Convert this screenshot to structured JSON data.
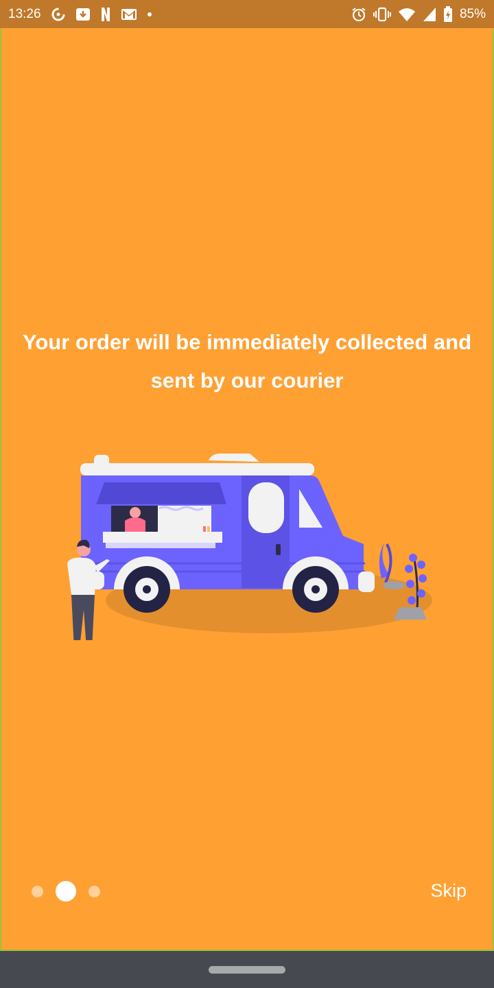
{
  "status_bar": {
    "time": "13:26",
    "battery": "85%",
    "left_icons": [
      "sync-icon",
      "download-icon",
      "netflix-icon",
      "gmail-icon",
      "dot-icon"
    ],
    "right_icons": [
      "alarm-icon",
      "vibrate-icon",
      "wifi-icon",
      "signal-icon",
      "battery-charging-icon"
    ]
  },
  "onboarding": {
    "headline": "Your order will be immediately collected and sent by our courier",
    "illustration": "food-truck-illustration",
    "pager": {
      "count": 3,
      "active_index": 1
    },
    "skip_label": "Skip"
  },
  "colors": {
    "background": "#ffa033",
    "status_bar": "#c0782a",
    "truck": "#6c63ff",
    "nav_bar": "#464a50"
  }
}
